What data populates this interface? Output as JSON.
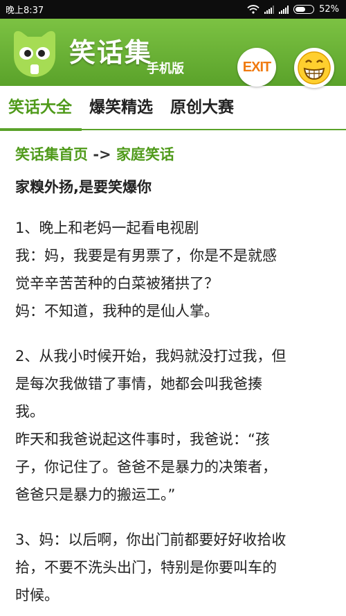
{
  "status": {
    "time": "晚上8:37",
    "battery": "52%"
  },
  "app": {
    "title": "笑话集",
    "subtitle": "手机版",
    "exit_label": "EXIT"
  },
  "tabs": [
    {
      "label": "笑话大全",
      "active": true
    },
    {
      "label": "爆笑精选",
      "active": false
    },
    {
      "label": "原创大赛",
      "active": false
    }
  ],
  "breadcrumb": {
    "home": "笑话集首页",
    "separator": "->",
    "category": "家庭笑话"
  },
  "article": {
    "title": "家糗外扬,是要笑爆你",
    "jokes": [
      [
        "1、晚上和老妈一起看电视剧",
        "我：妈，我要是有男票了，你是不是就感",
        "觉辛辛苦苦种的白菜被猪拱了？",
        "妈：不知道，我种的是仙人掌。"
      ],
      [
        "2、从我小时候开始，我妈就没打过我，但",
        "是每次我做错了事情，她都会叫我爸揍",
        "我。",
        "昨天和我爸说起这件事时，我爸说：“孩",
        "子，你记住了。爸爸不是暴力的决策者，",
        "爸爸只是暴力的搬运工。”"
      ],
      [
        "3、妈：以后啊，你出门前都要好好收拾收",
        "拾，不要不洗头出门，特别是你要叫车的",
        "时候。"
      ]
    ]
  },
  "colors": {
    "brand_green": "#5aa22a",
    "exit_orange": "#f07a10"
  }
}
